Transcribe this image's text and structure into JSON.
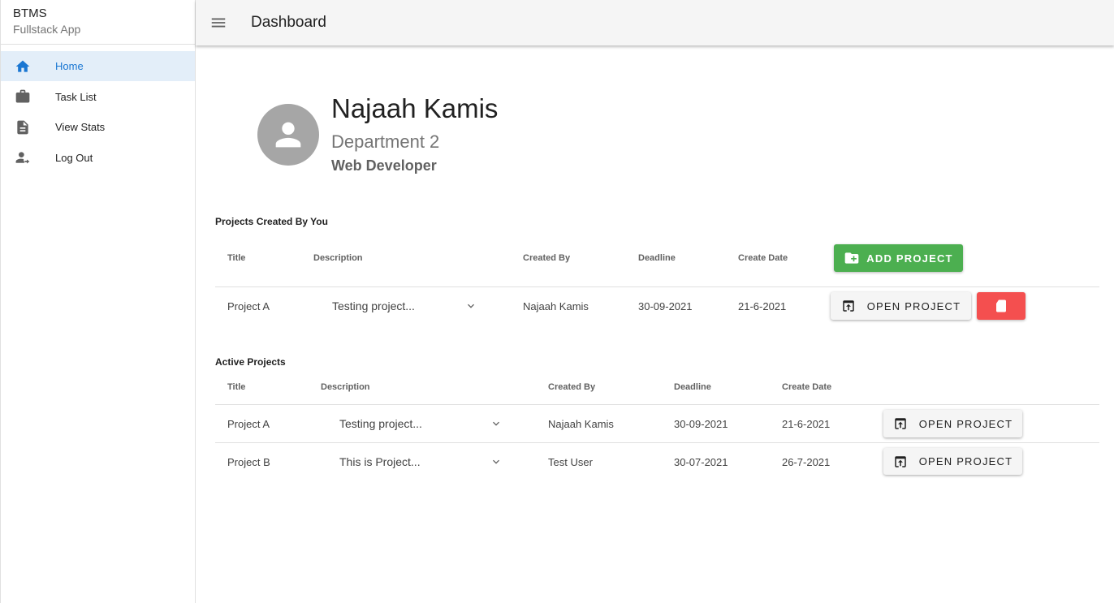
{
  "app": {
    "name": "BTMS",
    "subtitle": "Fullstack App"
  },
  "sidebar": {
    "items": [
      {
        "label": "Home",
        "icon": "home-icon",
        "active": true
      },
      {
        "label": "Task List",
        "icon": "briefcase-icon",
        "active": false
      },
      {
        "label": "View Stats",
        "icon": "document-icon",
        "active": false
      },
      {
        "label": "Log Out",
        "icon": "person-logout-icon",
        "active": false
      }
    ]
  },
  "header": {
    "title": "Dashboard"
  },
  "profile": {
    "name": "Najaah Kamis",
    "department": "Department 2",
    "role": "Web Developer"
  },
  "created_projects": {
    "title": "Projects Created By You",
    "columns": [
      "Title",
      "Description",
      "Created By",
      "Deadline",
      "Create Date"
    ],
    "add_button": "ADD PROJECT",
    "rows": [
      {
        "title": "Project A",
        "description": "Testing project...",
        "created_by": "Najaah Kamis",
        "deadline": "30-09-2021",
        "create_date": "21-6-2021",
        "open_label": "OPEN PROJECT"
      }
    ]
  },
  "active_projects": {
    "title": "Active Projects",
    "columns": [
      "Title",
      "Description",
      "Created By",
      "Deadline",
      "Create Date"
    ],
    "rows": [
      {
        "title": "Project A",
        "description": "Testing project...",
        "created_by": "Najaah Kamis",
        "deadline": "30-09-2021",
        "create_date": "21-6-2021",
        "open_label": "OPEN PROJECT"
      },
      {
        "title": "Project B",
        "description": "This is Project...",
        "created_by": "Test User",
        "deadline": "30-07-2021",
        "create_date": "26-7-2021",
        "open_label": "OPEN PROJECT"
      }
    ]
  },
  "colors": {
    "accent": "#1976d2",
    "add": "#4caf50",
    "delete": "#f44f4f",
    "active_bg": "#e3eef9"
  }
}
